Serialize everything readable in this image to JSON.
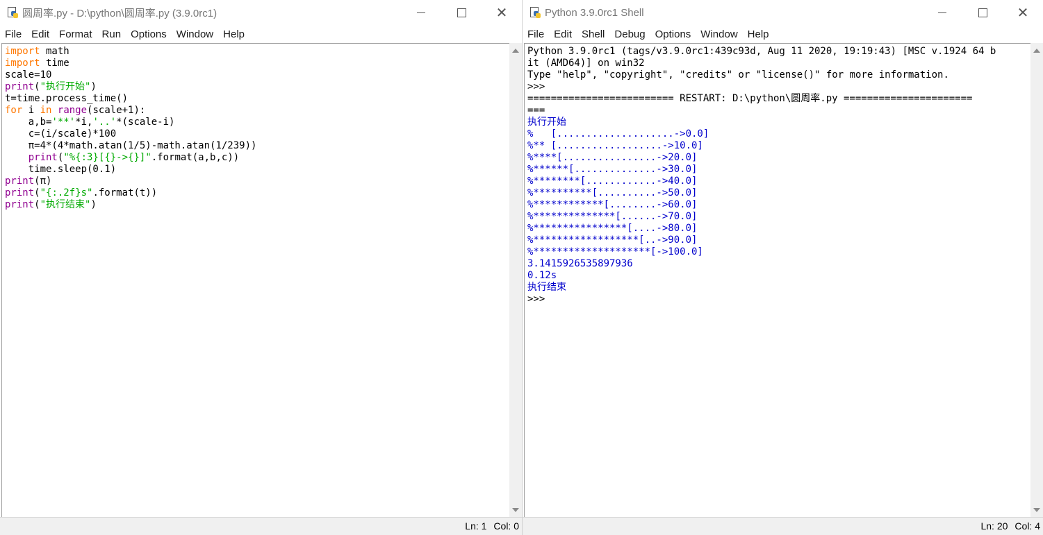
{
  "editor": {
    "title": "圆周率.py - D:\\python\\圆周率.py (3.9.0rc1)",
    "menu": [
      "File",
      "Edit",
      "Format",
      "Run",
      "Options",
      "Window",
      "Help"
    ],
    "status": {
      "line": "Ln: 1",
      "col": "Col: 0"
    },
    "code_lines": [
      "import math",
      "import time",
      "scale=10",
      "print(\"执行开始\")",
      "t=time.process_time()",
      "for i in range(scale+1):",
      "    a,b='**'*i,'..'*(scale-i)",
      "    c=(i/scale)*100",
      "    π=4*(4*math.atan(1/5)-math.atan(1/239))",
      "    print(\"%{:3}[{}->{}]\".format(a,b,c))",
      "    time.sleep(0.1)",
      "print(π)",
      "print(\"{:.2f}s\".format(t))",
      "print(\"执行结束\")"
    ]
  },
  "shell": {
    "title": "Python 3.9.0rc1 Shell",
    "menu": [
      "File",
      "Edit",
      "Shell",
      "Debug",
      "Options",
      "Window",
      "Help"
    ],
    "status": {
      "line": "Ln: 20",
      "col": "Col: 4"
    },
    "header_lines": [
      "Python 3.9.0rc1 (tags/v3.9.0rc1:439c93d, Aug 11 2020, 19:19:43) [MSC v.1924 64 b",
      "it (AMD64)] on win32",
      "Type \"help\", \"copyright\", \"credits\" or \"license()\" for more information.",
      ">>> ",
      "========================= RESTART: D:\\python\\圆周率.py ======================",
      "==="
    ],
    "output_lines": [
      "执行开始",
      "%   [....................->0.0]",
      "%** [..................->10.0]",
      "%****[................->20.0]",
      "%******[..............->30.0]",
      "%********[............->40.0]",
      "%**********[..........->50.0]",
      "%************[........->60.0]",
      "%**************[......->70.0]",
      "%****************[....->80.0]",
      "%******************[..->90.0]",
      "%********************[->100.0]",
      "3.141592653589793­6",
      "0.12s",
      "执行结束"
    ],
    "prompt": ">>> "
  }
}
